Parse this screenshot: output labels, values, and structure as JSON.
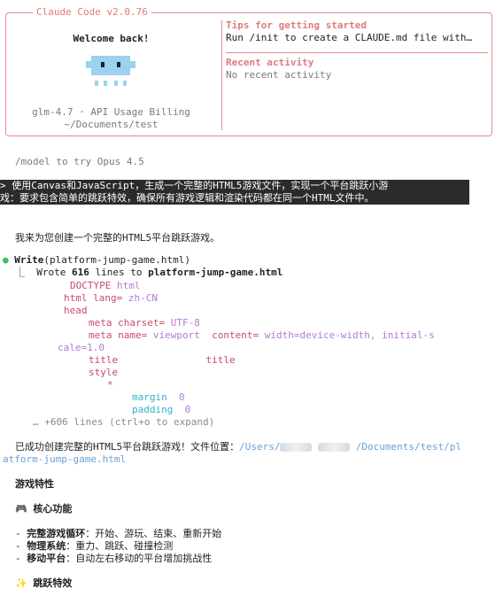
{
  "header": {
    "title": "Claude Code v2.0.76",
    "welcome": "Welcome back!",
    "model_line": "glm-4.7 · API Usage Billing",
    "cwd": "~/Documents/test"
  },
  "tips": {
    "title": "Tips for getting started",
    "text": "Run /init to create a CLAUDE.md file with…"
  },
  "activity": {
    "title": "Recent activity",
    "text": "No recent activity"
  },
  "hint": "/model to try Opus 4.5",
  "prompt": {
    "line1": "> 使用Canvas和JavaScript，生成一个完整的HTML5游戏文件，实现一个平台跳跃小游",
    "line2": "戏：要求包含简单的跳跃特效，确保所有游戏逻辑和渲染代码都在同一个HTML文件中。"
  },
  "reply_intro": "我来为您创建一个完整的HTML5平台跳跃游戏。",
  "tool": {
    "name": "Write",
    "args": "(platform-jump-game.html)",
    "result_prefix": "⎿  Wrote ",
    "result_count": "616",
    "result_mid": " lines to ",
    "result_file": "platform-jump-game.html",
    "more": "… +606 lines (ctrl+o to expand)"
  },
  "code": {
    "doctype": "DOCTYPE",
    "doctype_val": "html",
    "html": "html",
    "lang_attr": "lang=",
    "lang_val": "zh-CN",
    "head": "head",
    "meta": "meta",
    "charset_attr": "charset=",
    "charset_val": "UTF-8",
    "name_attr": "name=",
    "name_val": "viewport",
    "content_attr": "content=",
    "content_val": "width=device-width, initial-s",
    "content_cont": "cale=1.0",
    "title": "title",
    "title_close": "title",
    "style": "style",
    "star": "*",
    "margin": "margin",
    "margin_val": "0",
    "padding": "padding",
    "padding_val": "0"
  },
  "success": {
    "prefix": "已成功创建完整的HTML5平台跳跃游戏！文件位置：",
    "path1": "/Users/",
    "path2": "/Documents/test/pl",
    "path3": "atform-jump-game.html"
  },
  "features": {
    "heading": "游戏特性",
    "core_icon": "🎮",
    "core_title": "核心功能",
    "items": [
      {
        "label": "完整游戏循环",
        "text": "：开始、游玩、结束、重新开始"
      },
      {
        "label": "物理系统",
        "text": "：重力、跳跃、碰撞检测"
      },
      {
        "label": "移动平台",
        "text": "：自动左右移动的平台增加挑战性"
      }
    ],
    "jump_icon": "✨",
    "jump_title": "跳跃特效"
  }
}
